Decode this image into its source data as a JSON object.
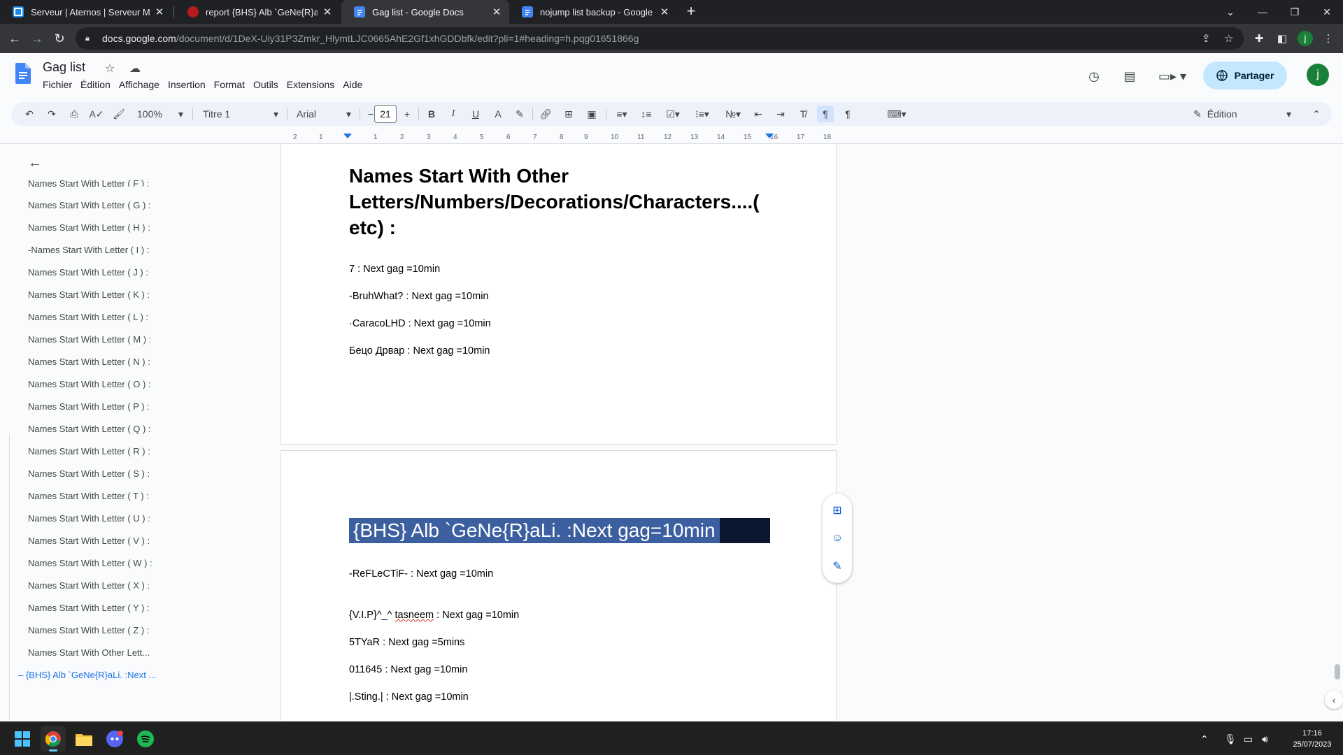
{
  "browser": {
    "tabs": [
      {
        "title": "Serveur | Aternos | Serveur Minec",
        "active": false
      },
      {
        "title": "report {BHS} Alb `GeNe{R}aLi. - Pl",
        "active": false
      },
      {
        "title": "Gag list - Google Docs",
        "active": true
      },
      {
        "title": "nojump list backup - Google Doc",
        "active": false
      }
    ],
    "url_host": "docs.google.com",
    "url_path": "/document/d/1DeX-Uiy31P3Zmkr_HlymtLJC0665AhE2Gf1xhGDDbfk/edit?pli=1#heading=h.pqg01651866g",
    "profile_initial": "j"
  },
  "docs": {
    "title": "Gag list",
    "menu": [
      "Fichier",
      "Édition",
      "Affichage",
      "Insertion",
      "Format",
      "Outils",
      "Extensions",
      "Aide"
    ],
    "share_label": "Partager",
    "avatar_initial": "j",
    "toolbar": {
      "zoom": "100%",
      "style": "Titre 1",
      "font": "Arial",
      "font_size": "21",
      "mode": "Édition"
    }
  },
  "ruler_ticks": [
    "2",
    "1",
    "1",
    "2",
    "3",
    "4",
    "5",
    "6",
    "7",
    "8",
    "9",
    "10",
    "11",
    "12",
    "13",
    "14",
    "15",
    "16",
    "17",
    "18"
  ],
  "outline": {
    "items": [
      "Names Start With Letter ( F ) :",
      "Names Start With Letter ( G ) :",
      "Names Start With Letter ( H ) :",
      "-Names Start With Letter ( I ) :",
      "Names Start With Letter ( J ) :",
      "Names Start With Letter ( K ) :",
      "Names Start With Letter ( L ) :",
      "Names Start With Letter ( M ) :",
      "Names Start With Letter ( N ) :",
      "Names Start With Letter ( O ) :",
      "Names Start With Letter ( P ) :",
      "Names Start With Letter ( Q ) :",
      "Names Start With Letter ( R ) :",
      "Names Start With Letter ( S ) :",
      "Names Start With Letter ( T ) :",
      "Names Start With Letter ( U ) :",
      "Names Start With Letter ( V ) :",
      "Names Start With Letter ( W ) :",
      "Names Start With Letter ( X ) :",
      "Names Start With Letter ( Y ) :",
      "Names Start With Letter ( Z ) :",
      "Names Start With Other Lett..."
    ],
    "active_item": "{BHS} Alb `GeNe{R}aLi. :Next ..."
  },
  "page1": {
    "heading_lines": [
      "Names Start With Other",
      "Letters/Numbers/Decorations/Characters....(",
      "etc) :"
    ],
    "entries": [
      "7 : Next gag =10min",
      "-BruhWhat? : Next gag =10min",
      "·CaracoLHD : Next gag =10min",
      "Бецо Дрвар : Next gag =10min"
    ]
  },
  "page2": {
    "selected_heading": "{BHS} Alb `GeNe{R}aLi. :Next gag=10min",
    "entries": [
      "-ReFLeCTiF- : Next gag =10min",
      "{V.I.P}^_^ tasneem : Next gag =10min",
      "5TYaR : Next gag =5mins",
      "011645 : Next gag =10min",
      "|.Sting.| : Next gag =10min"
    ],
    "squiggle_word": "tasneem"
  },
  "taskbar": {
    "time": "17:16",
    "date": "25/07/2023"
  },
  "colors": {
    "accent": "#1a73e8",
    "share_bg": "#c2e7ff",
    "selection": "#3b5f9f"
  }
}
